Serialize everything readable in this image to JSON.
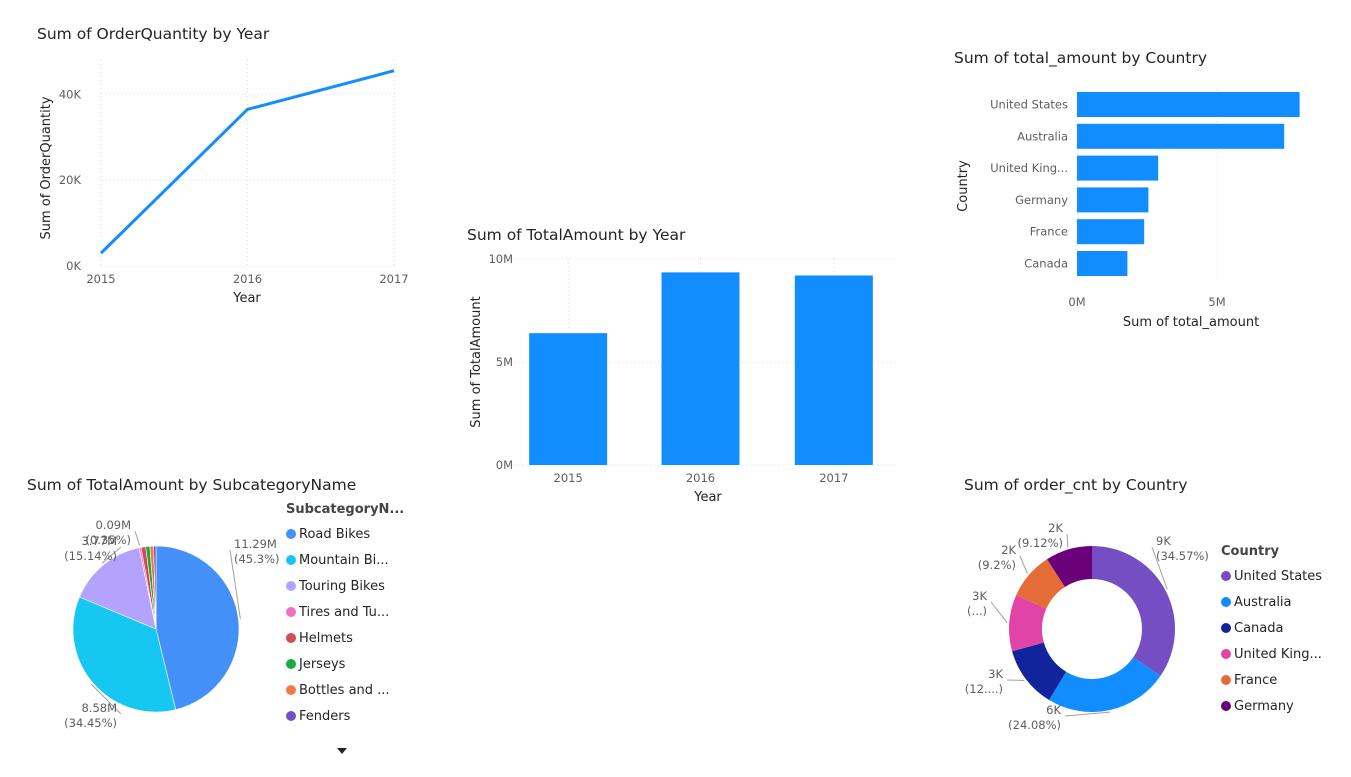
{
  "charts": {
    "line": {
      "title": "Sum of OrderQuantity by Year",
      "color": "#118DFF",
      "chart_data": {
        "type": "line",
        "title": "Sum of OrderQuantity by Year",
        "x": [
          "2015",
          "2016",
          "2017"
        ],
        "values": [
          3000,
          36500,
          45500
        ],
        "xlabel": "Year",
        "ylabel": "Sum of OrderQuantity",
        "ylim": [
          0,
          48000
        ],
        "yticks": [
          "0K",
          "20K",
          "40K"
        ],
        "grid": true
      }
    },
    "bar_year": {
      "title": "Sum of TotalAmount by Year",
      "color": "#118DFF",
      "chart_data": {
        "type": "bar",
        "title": "Sum of TotalAmount by Year",
        "categories": [
          "2015",
          "2016",
          "2017"
        ],
        "values": [
          6.4,
          9.35,
          9.2
        ],
        "xlabel": "Year",
        "ylabel": "Sum of TotalAmount",
        "ylim": [
          0,
          10
        ],
        "yticks": [
          "0M",
          "5M",
          "10M"
        ],
        "unit": "M",
        "grid": true
      }
    },
    "hbar_country": {
      "title": "Sum of total_amount by Country",
      "color": "#118DFF",
      "chart_data": {
        "type": "bar",
        "orientation": "horizontal",
        "title": "Sum of total_amount by Country",
        "categories": [
          "United States",
          "Australia",
          "United King...",
          "Germany",
          "France",
          "Canada"
        ],
        "values": [
          7.95,
          7.4,
          2.9,
          2.55,
          2.4,
          1.8
        ],
        "xlabel": "Sum of total_amount",
        "ylabel": "Country",
        "xlim": [
          0,
          8.5
        ],
        "xticks": [
          "0M",
          "5M"
        ],
        "unit": "M",
        "grid": true
      }
    },
    "pie_sub": {
      "title": "Sum of TotalAmount by SubcategoryName",
      "chart_data": {
        "type": "pie",
        "title": "Sum of TotalAmount by SubcategoryName",
        "categories": [
          "Road Bikes",
          "Mountain Bi...",
          "Touring Bikes",
          "Tires and Tu...",
          "Helmets",
          "Jerseys",
          "Bottles and ...",
          "Fenders"
        ],
        "values": [
          45.3,
          34.45,
          15.14,
          0.35,
          0.9,
          0.8,
          0.7,
          0.45
        ],
        "colors": [
          "#4290F8",
          "#16C7F2",
          "#B3A3FE",
          "#F26EC2",
          "#D24C5A",
          "#1AAB40",
          "#F17A3F",
          "#744EC2"
        ],
        "data_labels": [
          {
            "value": "11.29M",
            "pct": "(45.3%)"
          },
          {
            "value": "8.58M",
            "pct": "(34.45%)"
          },
          {
            "value": "3.77M",
            "pct": "(15.14%)"
          },
          {
            "value": "0.09M",
            "pct": "(0.35%)"
          }
        ],
        "legend": {
          "title": "SubcategoryN...",
          "position": "right"
        }
      }
    },
    "donut_country": {
      "title": "Sum of order_cnt by Country",
      "chart_data": {
        "type": "pie",
        "variant": "donut",
        "title": "Sum of order_cnt by Country",
        "categories": [
          "United States",
          "Australia",
          "Canada",
          "United King...",
          "France",
          "Germany"
        ],
        "values": [
          34.57,
          24.08,
          12.0,
          11.03,
          9.2,
          9.12
        ],
        "colors": [
          "#744EC2",
          "#118DFF",
          "#12239E",
          "#E044A7",
          "#E66C37",
          "#6B007B"
        ],
        "data_labels": [
          {
            "value": "9K",
            "pct": "(34.57%)"
          },
          {
            "value": "6K",
            "pct": "(24.08%)"
          },
          {
            "value": "3K",
            "pct": "(12....)"
          },
          {
            "value": "3K",
            "pct": "(...)"
          },
          {
            "value": "2K",
            "pct": "(9.2%)"
          },
          {
            "value": "2K",
            "pct": "(9.12%)"
          }
        ],
        "legend": {
          "title": "Country",
          "position": "right"
        }
      }
    }
  }
}
